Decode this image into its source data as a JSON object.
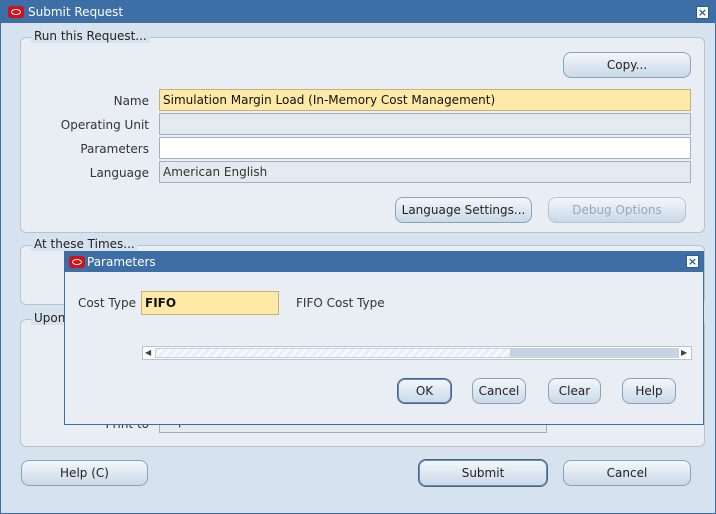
{
  "window": {
    "title": "Submit Request",
    "close": "×"
  },
  "run_section": {
    "title": "Run this Request...",
    "copy_label": "Copy...",
    "name_label": "Name",
    "name_value": "Simulation Margin Load (In-Memory Cost Management)",
    "ou_label": "Operating Unit",
    "ou_value": "",
    "params_label": "Parameters",
    "params_value": "",
    "lang_label": "Language",
    "lang_value": "American English",
    "lang_settings_label": "Language Settings...",
    "debug_label": "Debug Options"
  },
  "times_section": {
    "title": "At these Times..."
  },
  "upon_section": {
    "title": "Upon",
    "print_label": "Print to",
    "print_value": "noprint"
  },
  "footer": {
    "help_label": "Help (C)",
    "submit_label": "Submit",
    "cancel_label": "Cancel"
  },
  "dialog": {
    "title": "Parameters",
    "close": "×",
    "cost_type_label": "Cost Type",
    "cost_type_value": "FIFO",
    "cost_type_desc": "FIFO Cost Type",
    "scroll_left": "◀",
    "scroll_right": "▶",
    "ok_label": "OK",
    "cancel_label": "Cancel",
    "clear_label": "Clear",
    "help_label": "Help"
  }
}
